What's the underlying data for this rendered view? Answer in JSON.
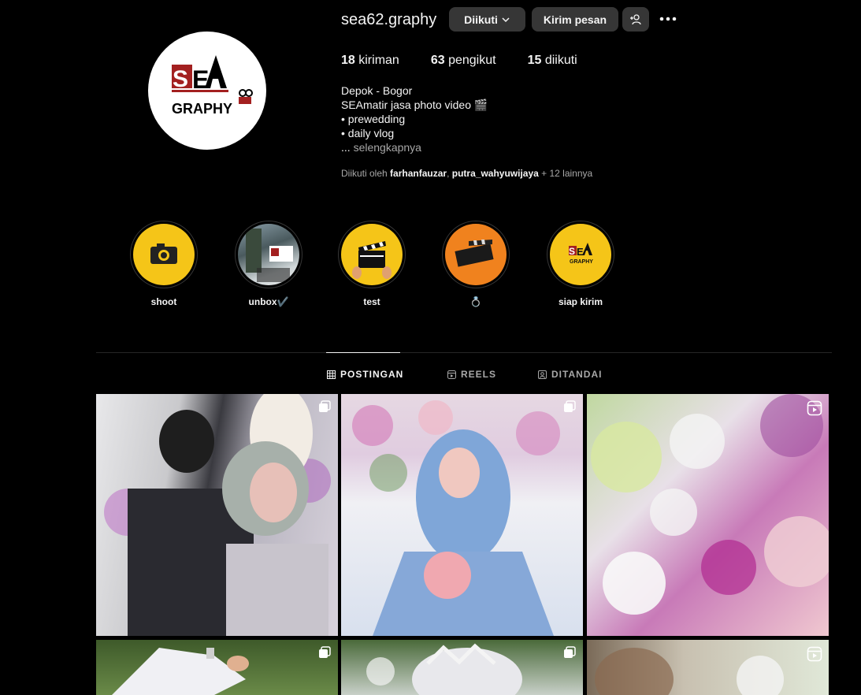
{
  "profile": {
    "username": "sea62.graphy",
    "follow_button": "Diikuti",
    "message_button": "Kirim pesan",
    "logo_text_top": "SEA",
    "logo_text_bottom": "GRAPHY"
  },
  "stats": [
    {
      "count": "18",
      "label": "kiriman"
    },
    {
      "count": "63",
      "label": "pengikut"
    },
    {
      "count": "15",
      "label": "diikuti"
    }
  ],
  "bio": {
    "line1": "Depok - Bogor",
    "line2": "SEAmatir jasa photo video 🎬",
    "line3": "• prewedding",
    "line4": "• daily vlog",
    "more_prefix": "...",
    "more_label": "selengkapnya"
  },
  "followed_by": {
    "prefix": "Diikuti oleh",
    "user1": "farhanfauzar",
    "sep": ",",
    "user2": "putra_wahyuwijaya",
    "suffix": "+ 12 lainnya"
  },
  "highlights": [
    {
      "label": "shoot",
      "icon": "camera-icon"
    },
    {
      "label": "unbox✔️",
      "icon": "photo-thumbnail"
    },
    {
      "label": "test",
      "icon": "clapperboard-icon"
    },
    {
      "label": "💍",
      "icon": "clapperboard-icon"
    },
    {
      "label": "siap kirim",
      "icon": "logo-icon"
    }
  ],
  "tabs": [
    {
      "label": "POSTINGAN",
      "icon": "grid-icon",
      "active": true
    },
    {
      "label": "REELS",
      "icon": "reels-icon",
      "active": false
    },
    {
      "label": "DITANDAI",
      "icon": "tagged-icon",
      "active": false
    }
  ],
  "posts": [
    {
      "type": "carousel",
      "subject": "bride and groom"
    },
    {
      "type": "carousel",
      "subject": "bride in blue"
    },
    {
      "type": "reel",
      "subject": "flowers"
    },
    {
      "type": "carousel",
      "subject": "outdoor"
    },
    {
      "type": "carousel",
      "subject": "decoration"
    },
    {
      "type": "reel",
      "subject": "flowers"
    }
  ],
  "colors": {
    "background": "#000000",
    "button_bg": "#363636",
    "highlight_yellow": "#f5c518",
    "logo_red": "#a32020"
  }
}
